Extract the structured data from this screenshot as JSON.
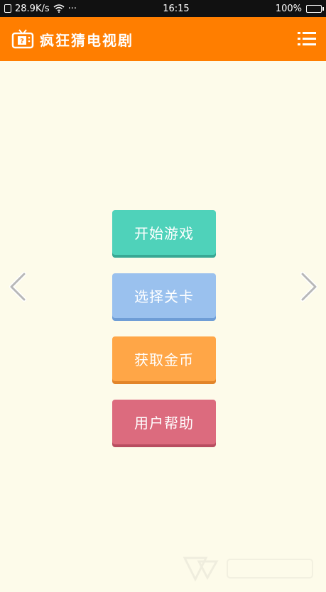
{
  "status_bar": {
    "speed": "28.9K/s",
    "dots": "···",
    "time": "16:15",
    "battery": "100%"
  },
  "app_bar": {
    "title": "疯狂猜电视剧"
  },
  "menu": {
    "start": "开始游戏",
    "select_level": "选择关卡",
    "get_coins": "获取金币",
    "help": "用户帮助"
  },
  "colors": {
    "app_bar": "#ff7e00",
    "background": "#fdfbea",
    "start": "#4fd2ba",
    "select_level": "#9ac1ee",
    "get_coins": "#ffa647",
    "help": "#dc6b7e"
  },
  "icons": {
    "tv": "tv-question-icon",
    "menu": "hamburger-menu-icon",
    "prev": "chevron-left-icon",
    "next": "chevron-right-icon"
  }
}
